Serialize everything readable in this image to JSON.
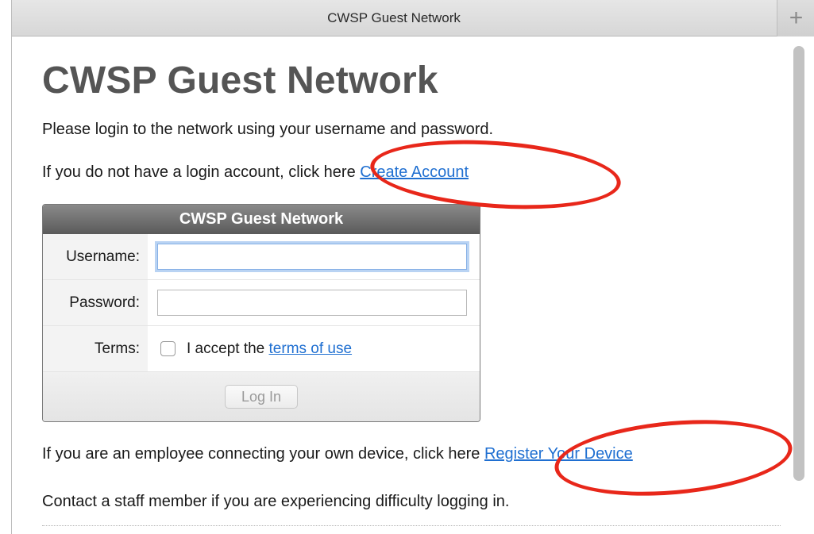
{
  "window": {
    "tab_title": "CWSP Guest Network",
    "new_tab_label": "+"
  },
  "page": {
    "title": "CWSP Guest Network",
    "intro": "Please login to the network using your username and password.",
    "create_account_prefix": "If you do not have a login account, click here ",
    "create_account_link": "Create Account",
    "employee_prefix": "If you are an employee connecting your own device, click here ",
    "register_device_link": "Register Your Device",
    "contact_text": "Contact a staff member if you are experiencing difficulty logging in."
  },
  "login_form": {
    "header": "CWSP Guest Network",
    "username_label": "Username:",
    "username_value": "",
    "password_label": "Password:",
    "password_value": "",
    "terms_label": "Terms:",
    "terms_accept_prefix": "I accept the ",
    "terms_link": "terms of use",
    "terms_checked": false,
    "login_button": "Log In"
  },
  "colors": {
    "link": "#1f6fd1",
    "title": "#555555",
    "annotation": "#e8271a"
  }
}
